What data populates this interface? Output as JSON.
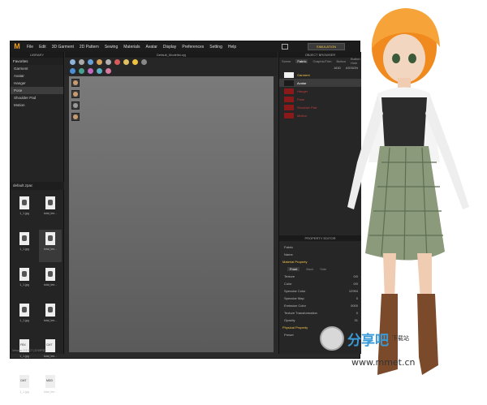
{
  "app": {
    "logo": "M",
    "menu": [
      "File",
      "Edit",
      "3D Garment",
      "2D Pattern",
      "Sewing",
      "Materials",
      "Avatar",
      "Display",
      "Preferences",
      "Setting",
      "Help"
    ],
    "simulation_label": "SIMULATION",
    "version": "Version: 2.2.107 (1019RD)"
  },
  "library": {
    "title": "LIBRARY",
    "favorites_label": "Favorites",
    "favorites": [
      "Garment",
      "Avatar",
      "Hanger",
      "Pose",
      "Shoulder Pad",
      "Motion"
    ],
    "selected": "Pose",
    "folder": "default.zpac",
    "files": [
      {
        "name": "1_1.jpg",
        "tag": ""
      },
      {
        "name": "total_lee...",
        "tag": ""
      },
      {
        "name": "1_1.jpg",
        "tag": ""
      },
      {
        "name": "total_lee...",
        "tag": ""
      },
      {
        "name": "1_1.jpg",
        "tag": ""
      },
      {
        "name": "total_lee...",
        "tag": ""
      },
      {
        "name": "1_1.jpg",
        "tag": ""
      },
      {
        "name": "total_lee...",
        "tag": ""
      },
      {
        "name": "1_1.jpg",
        "tag": "FBX"
      },
      {
        "name": "total_lee...",
        "tag": "CMT"
      },
      {
        "name": "1_1.jpg",
        "tag": "CMT"
      },
      {
        "name": "total_lee...",
        "tag": "MDD"
      }
    ]
  },
  "viewport": {
    "title": "Default_Modelist.zpj"
  },
  "object_browser": {
    "title": "OBJECT BROWSER",
    "tabs": [
      "Scene",
      "Fabric",
      "Graphic/Trim",
      "Button",
      "Button Hole"
    ],
    "active_tab": "Fabric",
    "add_label": "ADD",
    "assign_label": "ASSIGN",
    "fabrics": [
      {
        "name": "Garment",
        "color": "#f2f2f2"
      },
      {
        "name": "Avatar",
        "color": "#1b1b1b"
      },
      {
        "name": "Hanger",
        "color": "#8a1a1a"
      },
      {
        "name": "Pose",
        "color": "#8a1a1a"
      },
      {
        "name": "Shoulder Pad",
        "color": "#8a1a1a"
      },
      {
        "name": "Motion",
        "color": "#8a1a1a"
      }
    ]
  },
  "property_editor": {
    "title": "PROPERTY EDITOR",
    "fabric_label": "Fabric",
    "name_label": "Name",
    "material_section": "Material Property",
    "tabs": [
      "Front",
      "Back",
      "Side"
    ],
    "rows": [
      {
        "label": "Texture",
        "value": "0/0"
      },
      {
        "label": "Color",
        "value": "0/0"
      },
      {
        "label": "Specular Color",
        "value": "12994"
      },
      {
        "label": "Specular Map",
        "value": "0"
      },
      {
        "label": "Emission Color",
        "value": "0000"
      },
      {
        "label": "Texture Transformation",
        "value": "0"
      },
      {
        "label": "Opacity",
        "value": "31"
      }
    ],
    "physical_section": "Physical Property",
    "preset_label": "Preset"
  },
  "watermark": {
    "brand": "分享吧",
    "sub": "下载站",
    "url": "www.mmet.cn"
  },
  "colors": {
    "accent": "#f4c64a",
    "bg": "#2a2a2a",
    "link": "#3a9ad8"
  }
}
